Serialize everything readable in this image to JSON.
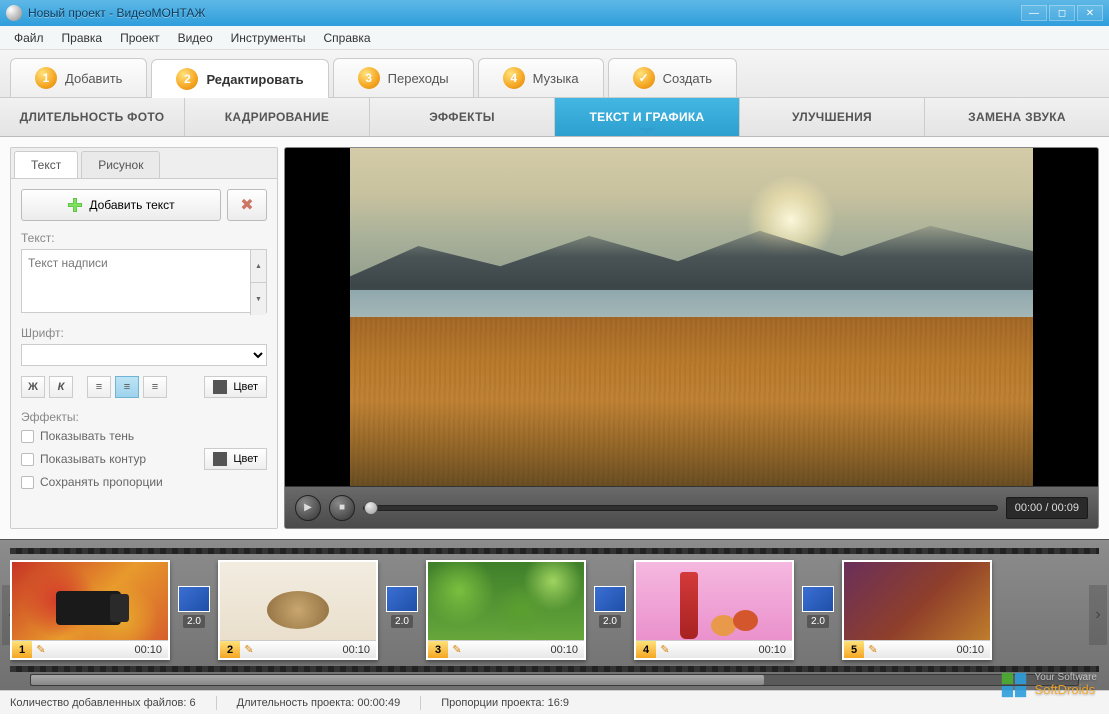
{
  "window": {
    "title": "Новый проект - ВидеоМОНТАЖ"
  },
  "menu": [
    "Файл",
    "Правка",
    "Проект",
    "Видео",
    "Инструменты",
    "Справка"
  ],
  "steps": [
    {
      "num": "1",
      "label": "Добавить"
    },
    {
      "num": "2",
      "label": "Редактировать"
    },
    {
      "num": "3",
      "label": "Переходы"
    },
    {
      "num": "4",
      "label": "Музыка"
    },
    {
      "num": "✓",
      "label": "Создать"
    }
  ],
  "subtabs": [
    "ДЛИТЕЛЬНОСТЬ ФОТО",
    "КАДРИРОВАНИЕ",
    "ЭФФЕКТЫ",
    "ТЕКСТ И ГРАФИКА",
    "УЛУЧШЕНИЯ",
    "ЗАМЕНА ЗВУКА"
  ],
  "left": {
    "tabs": [
      "Текст",
      "Рисунок"
    ],
    "add_text_btn": "Добавить текст",
    "text_lbl": "Текст:",
    "text_value": "Текст надписи",
    "font_lbl": "Шрифт:",
    "style": {
      "bold": "Ж",
      "italic": "К"
    },
    "color_btn": "Цвет",
    "fx_lbl": "Эффекты:",
    "fx": {
      "shadow": "Показывать тень",
      "outline": "Показывать контур",
      "outline_color": "Цвет",
      "keep_ratio": "Сохранять пропорции"
    }
  },
  "player": {
    "time": "00:00 / 00:09"
  },
  "timeline": {
    "clips": [
      {
        "num": "1",
        "time": "00:10"
      },
      {
        "num": "2",
        "time": "00:10"
      },
      {
        "num": "3",
        "time": "00:10"
      },
      {
        "num": "4",
        "time": "00:10"
      },
      {
        "num": "5",
        "time": "00:10"
      }
    ],
    "transition_dur": "2.0"
  },
  "status": {
    "files_lbl": "Количество добавленных файлов:",
    "files_val": "6",
    "dur_lbl": "Длительность проекта:",
    "dur_val": "00:00:49",
    "ratio_lbl": "Пропорции проекта:",
    "ratio_val": "16:9"
  },
  "watermark": {
    "l1": "Your Software",
    "l2": "SoftDroids"
  }
}
